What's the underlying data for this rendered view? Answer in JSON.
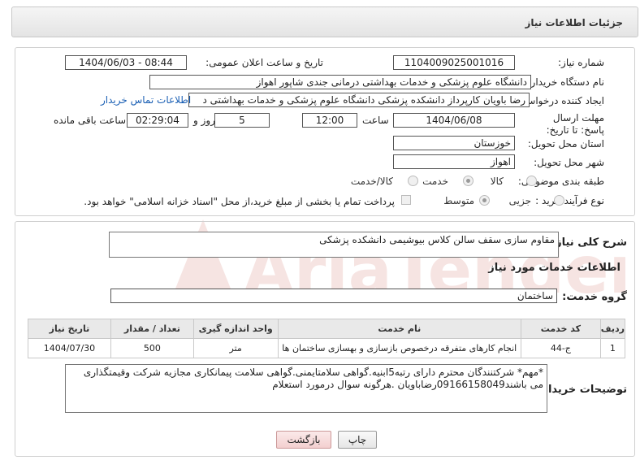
{
  "header": {
    "title": "جزئیات اطلاعات نیاز"
  },
  "fields": {
    "need_number_label": "شماره نیاز:",
    "need_number": "1104009025001016",
    "announce_label": "تاریخ و ساعت اعلان عمومی:",
    "announce_value": "1404/06/03 - 08:44",
    "buyer_org_label": "نام دستگاه خریدار:",
    "buyer_org": "دانشگاه علوم پزشکی و خدمات بهداشتی درمانی جندی شاپور اهواز",
    "creator_label": "ایجاد کننده درخواست:",
    "creator": "رضا باویان کارپرداز دانشکده پزشکی دانشگاه علوم پزشکی و خدمات بهداشتی د",
    "contact_link": "اطلاعات تماس خریدار",
    "deadline_label": "مهلت ارسال پاسخ: تا تاریخ:",
    "deadline_date": "1404/06/08",
    "time_label": "ساعت",
    "deadline_time": "12:00",
    "days_value": "5",
    "days_label": "روز و",
    "remaining_time": "02:29:04",
    "remaining_label": "ساعت باقی مانده",
    "province_label": "استان محل تحویل:",
    "province": "خوزستان",
    "city_label": "شهر محل تحویل:",
    "city": "اهواز",
    "category_label": "طبقه بندی موضوعی:",
    "category_options": [
      "کالا",
      "خدمت",
      "کالا/خدمت"
    ],
    "category_selected": "خدمت",
    "process_label": "نوع فرآیند خرید :",
    "process_options": [
      "جزیی",
      "متوسط"
    ],
    "process_selected": "متوسط",
    "payment_note": "پرداخت تمام یا بخشی از مبلغ خرید،از محل \"اسناد خزانه اسلامی\" خواهد بود."
  },
  "description": {
    "label": "شرح کلی نیاز:",
    "value": "مقاوم سازی سقف سالن کلاس بیوشیمی دانشکده پزشکی"
  },
  "services": {
    "section_title": "اطلاعات خدمات مورد نیاز",
    "group_label": "گروه خدمت:",
    "group_value": "ساختمان",
    "columns": [
      "ردیف",
      "کد خدمت",
      "نام خدمت",
      "واحد اندازه گیری",
      "تعداد / مقدار",
      "تاریخ نیاز"
    ],
    "rows": [
      [
        "1",
        "ج-44",
        "انجام کارهای متفرقه درخصوص بازسازی و بهسازی ساختمان ها",
        "متر",
        "500",
        "1404/07/30"
      ]
    ]
  },
  "buyer_notes": {
    "label": "توضیحات خریدار:",
    "value": "*مهم* شرکتنندگان محترم دارای رتبه5ابنیه.گواهی سلامتایمنی.گواهی سلامت پیمانکاری مجازیه شرکت وقیمتگذاری می باشند09166158049رضاباویان .هرگونه سوال درمورد استعلام"
  },
  "buttons": {
    "print": "چاپ",
    "back": "بازگشت"
  },
  "watermark": {
    "text": "AriaTender.neT"
  }
}
